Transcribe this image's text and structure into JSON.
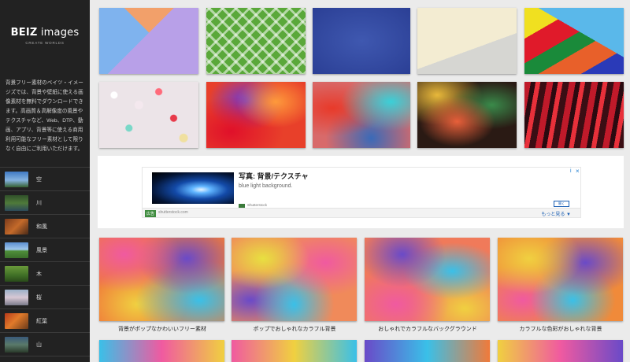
{
  "site": {
    "name_bold": "BEIZ",
    "name_rest": " images",
    "tagline": "CREATE WORLDS"
  },
  "sidebar": {
    "intro": "背景フリー素材のベイツ・イメージズでは、背景や壁紙に使える画像素材を無料でダウンロードできます。高画質＆高解像度の風景やテクスチャなど、Web、DTP、動画、アプリ、背景等に使える商用利用可能なフリー素材として限りなく自由にご利用いただけます。",
    "categories": [
      {
        "label": "空"
      },
      {
        "label": "川"
      },
      {
        "label": "和風"
      },
      {
        "label": "風景"
      },
      {
        "label": "木"
      },
      {
        "label": "桜"
      },
      {
        "label": "紅葉"
      },
      {
        "label": "山"
      }
    ]
  },
  "ad": {
    "title": "写真: 背景/テクスチャ",
    "description": "blue light background.",
    "brand": "Shutterstock",
    "badge": "広告",
    "url": "shutterstock.com",
    "more": "もっと見る ▼",
    "open": "開く",
    "info_icon": "i",
    "close_icon": "×"
  },
  "featured": {
    "captions": [
      "背景がポップなかわいいフリー素材",
      "ポップでおしゃれなカラフル背景",
      "おしゃれでカラフルなバックグラウンド",
      "カラフルな色彩がおしゃれな背景"
    ]
  },
  "colors": {
    "sidebar_bg": "#222222",
    "main_bg": "#ebebeb",
    "ad_link": "#1a5fb4"
  }
}
